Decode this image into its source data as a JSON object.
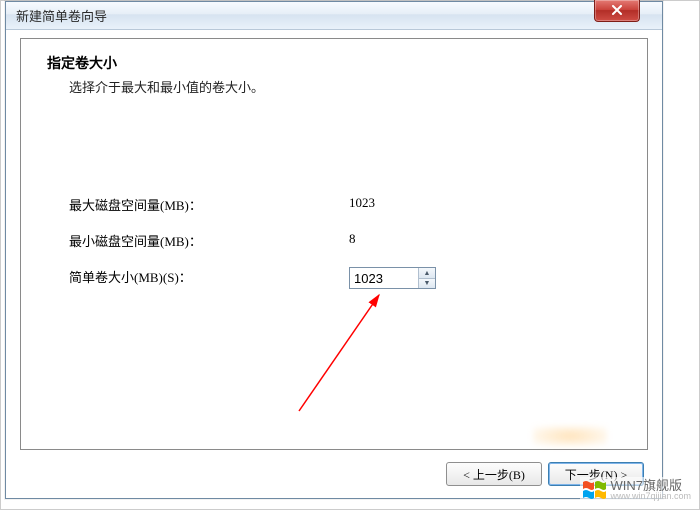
{
  "window": {
    "title": "新建简单卷向导",
    "close_label": "X"
  },
  "page": {
    "heading": "指定卷大小",
    "subheading": "选择介于最大和最小值的卷大小。"
  },
  "fields": {
    "max_label": "最大磁盘空间量(MB)：",
    "max_value": "1023",
    "min_label": "最小磁盘空间量(MB)：",
    "min_value": "8",
    "size_label": "简单卷大小(MB)(S)：",
    "size_value": "1023"
  },
  "buttons": {
    "back": "< 上一步(B)",
    "next": "下一步(N) >"
  },
  "watermark": {
    "text": "WIN7旗舰版",
    "url": "www.win7qijian.com"
  }
}
